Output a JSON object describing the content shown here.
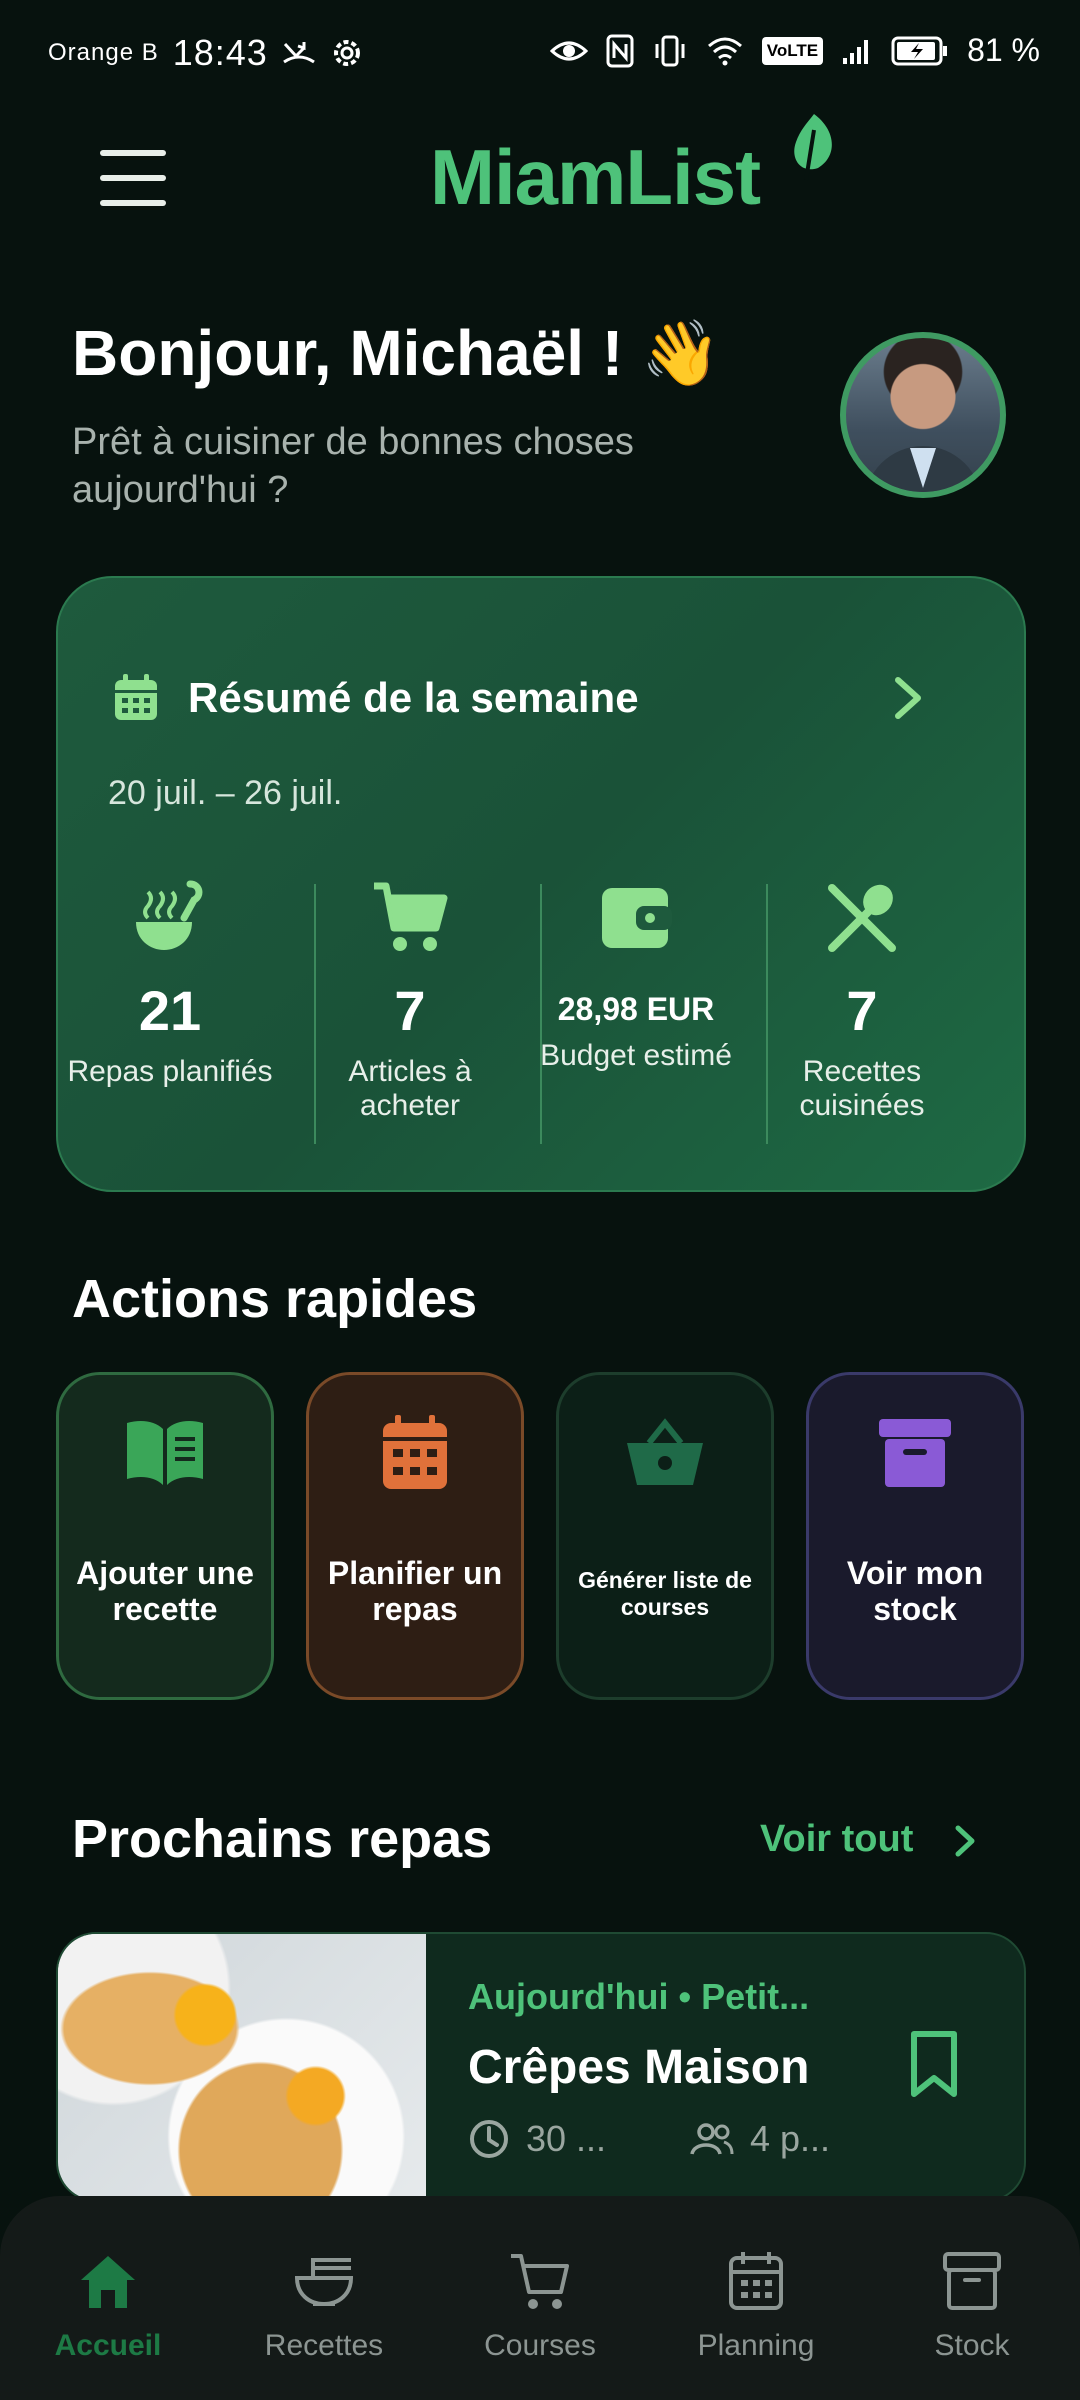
{
  "status_bar": {
    "carrier": "Orange B",
    "time": "18:43",
    "volte": "VoLTE",
    "battery": "81 %"
  },
  "header": {
    "app_name": "MiamList"
  },
  "greeting": {
    "title": "Bonjour, Michaël ! 👋",
    "subtitle": "Prêt à cuisiner de bonnes choses aujourd'hui ?"
  },
  "summary": {
    "title": "Résumé de la semaine",
    "dates": "20 juil. – 26 juil.",
    "stats": [
      {
        "icon": "ladle-icon",
        "value": "21",
        "label": "Repas planifiés"
      },
      {
        "icon": "cart-icon",
        "value": "7",
        "label": "Articles à acheter"
      },
      {
        "icon": "wallet-icon",
        "value": "28,98 EUR",
        "label": "Budget estimé"
      },
      {
        "icon": "utensils-icon",
        "value": "7",
        "label": "Recettes cuisinées"
      }
    ]
  },
  "quick_actions": {
    "title": "Actions rapides",
    "items": [
      {
        "icon": "book-icon",
        "label": "Ajouter une recette",
        "color": "#2f7d45"
      },
      {
        "icon": "calendar-icon",
        "label": "Planifier un repas",
        "color": "#e0713a"
      },
      {
        "icon": "basket-icon",
        "label": "Générer liste de courses",
        "color": "#1f6a48"
      },
      {
        "icon": "archive-icon",
        "label": "Voir mon stock",
        "color": "#8a5ad6"
      }
    ]
  },
  "upcoming": {
    "title": "Prochains repas",
    "see_all": "Voir tout",
    "meal": {
      "tag": "Aujourd'hui • Petit...",
      "name": "Crêpes Maison",
      "time": "30 ...",
      "servings": "4 p..."
    }
  },
  "bottom_nav": {
    "items": [
      {
        "icon": "home-icon",
        "label": "Accueil",
        "active": true
      },
      {
        "icon": "bowl-icon",
        "label": "Recettes"
      },
      {
        "icon": "cart-icon",
        "label": "Courses"
      },
      {
        "icon": "calendar-icon",
        "label": "Planning"
      },
      {
        "icon": "archive-icon",
        "label": "Stock"
      }
    ]
  },
  "colors": {
    "accent": "#4ec27a",
    "background": "#07120e",
    "card": "#1e5a3d"
  }
}
